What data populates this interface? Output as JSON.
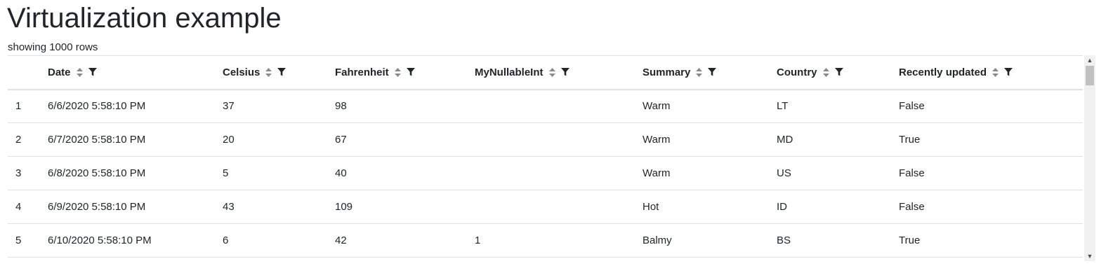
{
  "page": {
    "title": "Virtualization example",
    "row_count_text": "showing 1000 rows"
  },
  "grid": {
    "columns": [
      {
        "key": "idx",
        "label": ""
      },
      {
        "key": "date",
        "label": "Date"
      },
      {
        "key": "celsius",
        "label": "Celsius"
      },
      {
        "key": "fahrenheit",
        "label": "Fahrenheit"
      },
      {
        "key": "nullable",
        "label": "MyNullableInt"
      },
      {
        "key": "summary",
        "label": "Summary"
      },
      {
        "key": "country",
        "label": "Country"
      },
      {
        "key": "recent",
        "label": "Recently updated"
      }
    ],
    "rows": [
      {
        "idx": "1",
        "date": "6/6/2020 5:58:10 PM",
        "celsius": "37",
        "fahrenheit": "98",
        "nullable": "",
        "summary": "Warm",
        "country": "LT",
        "recent": "False"
      },
      {
        "idx": "2",
        "date": "6/7/2020 5:58:10 PM",
        "celsius": "20",
        "fahrenheit": "67",
        "nullable": "",
        "summary": "Warm",
        "country": "MD",
        "recent": "True"
      },
      {
        "idx": "3",
        "date": "6/8/2020 5:58:10 PM",
        "celsius": "5",
        "fahrenheit": "40",
        "nullable": "",
        "summary": "Warm",
        "country": "US",
        "recent": "False"
      },
      {
        "idx": "4",
        "date": "6/9/2020 5:58:10 PM",
        "celsius": "43",
        "fahrenheit": "109",
        "nullable": "",
        "summary": "Hot",
        "country": "ID",
        "recent": "False"
      },
      {
        "idx": "5",
        "date": "6/10/2020 5:58:10 PM",
        "celsius": "6",
        "fahrenheit": "42",
        "nullable": "1",
        "summary": "Balmy",
        "country": "BS",
        "recent": "True"
      }
    ]
  },
  "icons": {
    "sort": "sort-icon",
    "filter": "filter-icon",
    "scroll_up": "chevron-up-icon",
    "scroll_down": "chevron-down-icon"
  },
  "colors": {
    "text": "#212529",
    "border": "#dee2e6",
    "sort_icon": "#8a8a8a",
    "filter_icon": "#212529"
  }
}
